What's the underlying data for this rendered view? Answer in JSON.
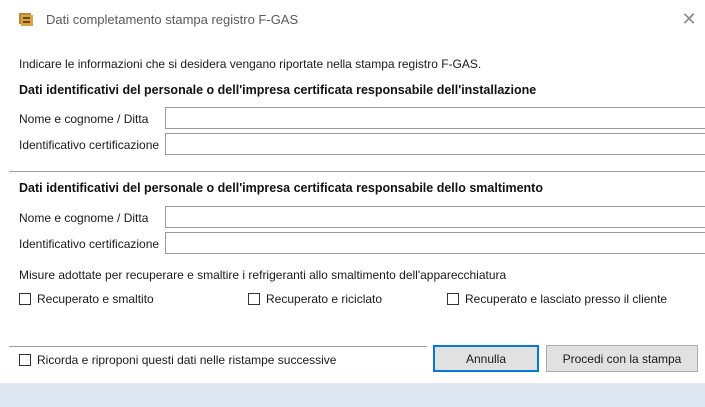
{
  "window": {
    "title": "Dati completamento stampa registro F-GAS",
    "close_glyph": "✕"
  },
  "intro": "Indicare le informazioni che si desidera vengano riportate nella stampa registro F-GAS.",
  "installation": {
    "heading": "Dati identificativi del personale o dell'impresa certificata responsabile dell'installazione",
    "name_label": "Nome e cognome / Ditta",
    "name_value": "",
    "cert_label": "Identificativo certificazione",
    "cert_value": ""
  },
  "disposal": {
    "heading": "Dati identificativi del personale o dell'impresa certificata responsabile dello smaltimento",
    "name_label": "Nome e cognome / Ditta",
    "name_value": "",
    "cert_label": "Identificativo certificazione",
    "cert_value": ""
  },
  "measures": {
    "label": "Misure adottate per recuperare e smaltire i refrigeranti allo smaltimento dell'apparecchiatura",
    "options": [
      {
        "label": "Recuperato e smaltito",
        "checked": false
      },
      {
        "label": "Recuperato e riciclato",
        "checked": false
      },
      {
        "label": "Recuperato e lasciato presso il cliente",
        "checked": false
      }
    ]
  },
  "remember": {
    "label": "Ricorda e riproponi questi dati nelle ristampe successive",
    "checked": false
  },
  "buttons": {
    "cancel": "Annulla",
    "proceed": "Procedi con la stampa"
  },
  "colors": {
    "footer_bg": "#dfe8f2",
    "default_button_border": "#0078d7"
  }
}
